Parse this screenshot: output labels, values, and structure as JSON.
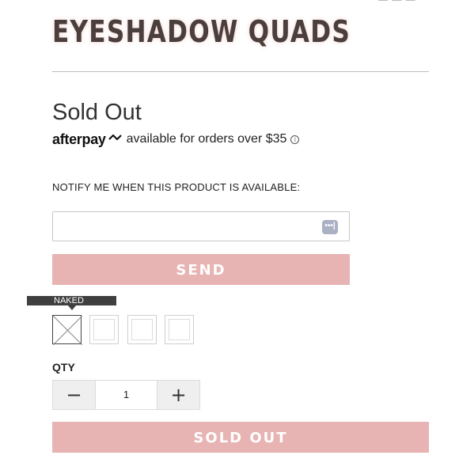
{
  "header": {
    "top_cut_text": "— — —"
  },
  "product": {
    "title": "EYESHADOW QUADS",
    "status": "Sold Out"
  },
  "afterpay": {
    "brand": "afterpay",
    "text": "available for orders over $35",
    "info_symbol": "i"
  },
  "notify": {
    "label": "NOTIFY ME WHEN THIS PRODUCT IS AVAILABLE:",
    "email_value": "",
    "email_placeholder": "",
    "autofill_symbol": "•••|",
    "send_label": "SEND"
  },
  "variants": {
    "tooltip": "NAKED",
    "swatches": [
      "naked",
      "",
      "",
      ""
    ]
  },
  "quantity": {
    "label": "QTY",
    "value": "1",
    "decrement_symbol": "−",
    "increment_symbol": "+"
  },
  "cart": {
    "button_label": "SOLD OUT"
  },
  "colors": {
    "accent_pink": "#e8b3b3",
    "title": "#4a3f3c"
  }
}
